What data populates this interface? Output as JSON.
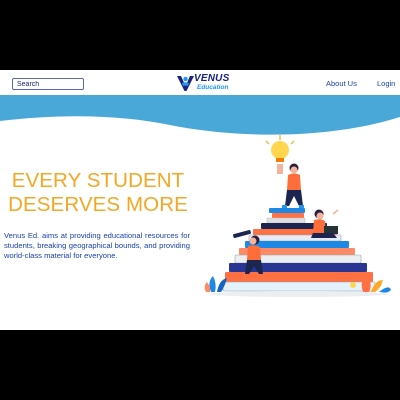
{
  "header": {
    "search": {
      "placeholder": "Search"
    },
    "logo": {
      "line1": "VENUS",
      "line2": "Education"
    },
    "nav": {
      "about": "About Us",
      "login": "Login"
    }
  },
  "hero": {
    "headline_line1": "EVERY STUDENT",
    "headline_line2": "DESERVES MORE",
    "description": "Venus Ed. aims at providing educational resources for students, breaking geographical bounds, and providing world-class material for everyone."
  },
  "colors": {
    "accent": "#f5a623",
    "brand_blue": "#1a3fb0",
    "wave": "#4aa8d8",
    "letterbox": "#000000"
  },
  "illustration": {
    "subject": "students-on-books-illustration",
    "icons": [
      "lightbulb-icon",
      "telescope-icon",
      "laptop-icon",
      "books-stack-icon",
      "plant-icon"
    ]
  }
}
